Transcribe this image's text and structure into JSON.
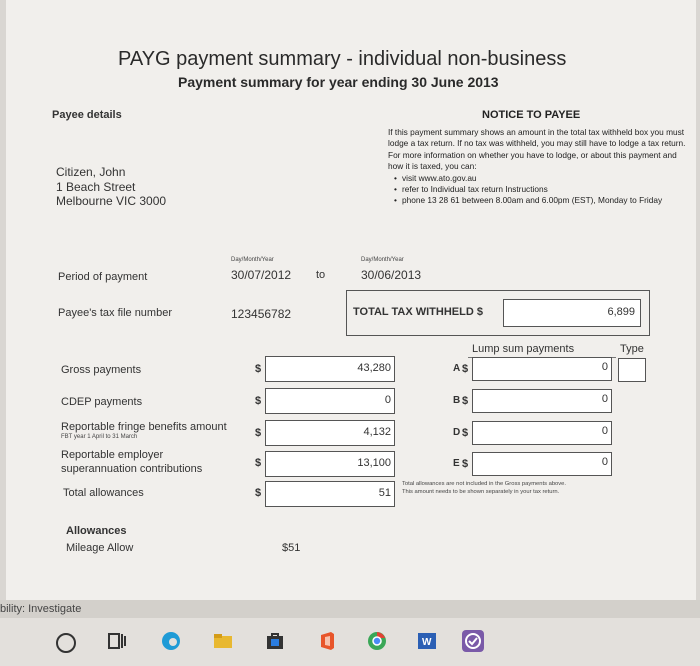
{
  "header": {
    "title": "PAYG payment summary - individual non-business",
    "subtitle": "Payment summary for year ending 30 June 2013"
  },
  "payee": {
    "section_label": "Payee details",
    "name": "Citizen, John",
    "address1": "1 Beach Street",
    "address2": "Melbourne VIC 3000"
  },
  "notice": {
    "title": "NOTICE TO PAYEE",
    "para1": "If this payment summary shows an amount in the total tax withheld box you must lodge a tax return. If no tax was withheld, you may still have to lodge a tax return.",
    "para2": "For more information on whether you have to lodge, or about this payment and how it is taxed, you can:",
    "bullet1": "visit www.ato.gov.au",
    "bullet2": "refer to Individual tax return Instructions",
    "bullet3": "phone 13 28 61 between 8.00am and 6.00pm (EST), Monday to Friday"
  },
  "period": {
    "label": "Period of payment",
    "from_caption": "Day/Month/Year",
    "from": "30/07/2012",
    "to_word": "to",
    "to_caption": "Day/Month/Year",
    "to": "30/06/2013"
  },
  "tfn": {
    "label": "Payee's tax file number",
    "value": "123456782"
  },
  "total_tax": {
    "label": "TOTAL TAX WITHHELD $",
    "value": "6,899"
  },
  "lump": {
    "header": "Lump sum payments",
    "type_header": "Type",
    "dollar": "$",
    "A_letter": "A",
    "A_value": "0",
    "B_letter": "B",
    "B_value": "0",
    "D_letter": "D",
    "D_value": "0",
    "E_letter": "E",
    "E_value": "0"
  },
  "payments": {
    "dollar": "$",
    "gross_label": "Gross payments",
    "gross_value": "43,280",
    "cdep_label": "CDEP payments",
    "cdep_value": "0",
    "rfb_label": "Reportable fringe benefits amount",
    "rfb_caption": "FBT year 1 April to 31 March",
    "rfb_value": "4,132",
    "resc_label_1": "Reportable employer",
    "resc_label_2": "superannuation contributions",
    "resc_value": "13,100",
    "allow_label": "Total allowances",
    "allow_value": "51",
    "allow_note_1": "Total allowances are not included in the Gross payments above.",
    "allow_note_2": "This amount needs to be shown separately in your tax return."
  },
  "allowances": {
    "heading": "Allowances",
    "item_label": "Mileage Allow",
    "item_value": "$51"
  },
  "status_bar": {
    "text": "bility: Investigate"
  },
  "taskbar": {
    "icons": [
      "search-circle-icon",
      "task-view-icon",
      "edge-icon",
      "file-explorer-icon",
      "store-icon",
      "office-icon",
      "chrome-icon",
      "word-icon",
      "checkmark-app-icon"
    ]
  }
}
